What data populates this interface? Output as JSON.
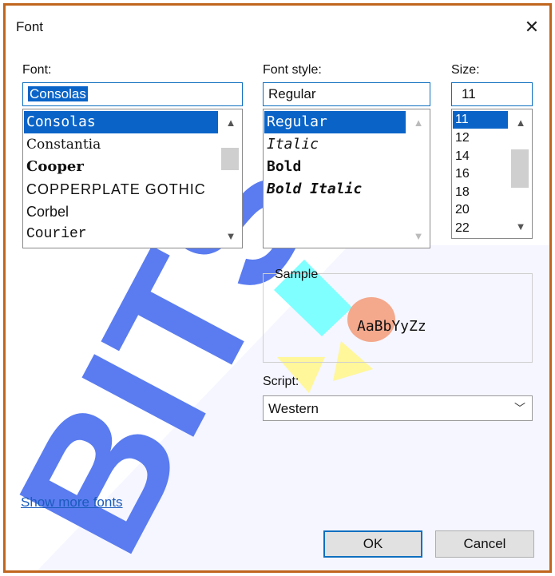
{
  "dialog": {
    "title": "Font",
    "close_icon": "close-icon"
  },
  "font": {
    "label": "Font:",
    "value": "Consolas",
    "items": [
      "Consolas",
      "Constantia",
      "Cooper",
      "COPPERPLATE GOTHIC",
      "Corbel",
      "Courier"
    ],
    "selected": "Consolas"
  },
  "style": {
    "label": "Font style:",
    "value": "Regular",
    "items": [
      "Regular",
      "Italic",
      "Bold",
      "Bold Italic"
    ],
    "selected": "Regular"
  },
  "size": {
    "label": "Size:",
    "value": "11",
    "items": [
      "11",
      "12",
      "14",
      "16",
      "18",
      "20",
      "22"
    ],
    "selected": "11"
  },
  "sample": {
    "label": "Sample",
    "text": "AaBbYyZz"
  },
  "script": {
    "label": "Script:",
    "value": "Western"
  },
  "links": {
    "show_more": "Show more fonts"
  },
  "buttons": {
    "ok": "OK",
    "cancel": "Cancel"
  },
  "watermark": {
    "text": "BITS"
  },
  "colors": {
    "frame": "#c0651e",
    "selection": "#0a64c8",
    "focus_border": "#0f6fbf",
    "link": "#1a5bbd",
    "wm_blue": "#5a7cf0",
    "wm_cyan": "#7fffff",
    "wm_salmon": "#f4a88c",
    "wm_yellow": "#fff79a"
  }
}
